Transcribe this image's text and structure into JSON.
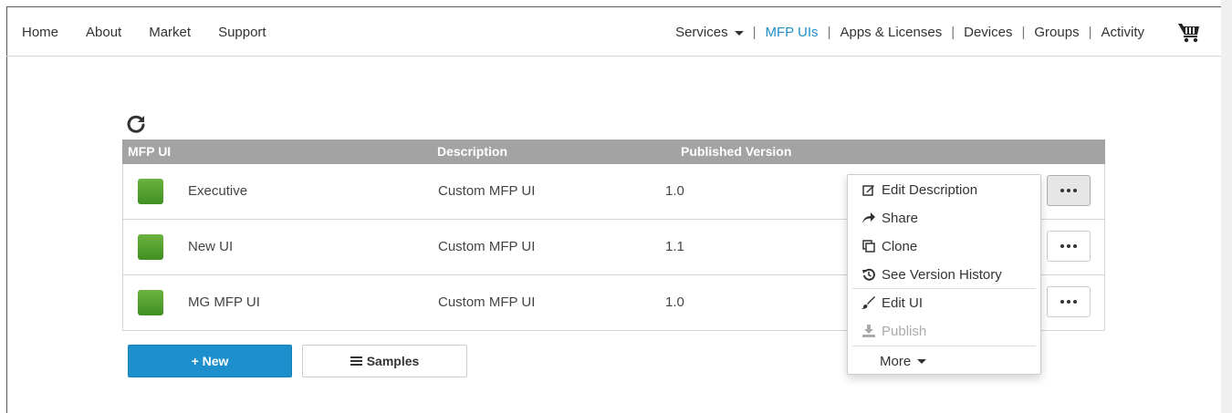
{
  "nav": {
    "left_items": [
      "Home",
      "About",
      "Market",
      "Support"
    ],
    "right_items": [
      {
        "label": "Services",
        "dropdown": true,
        "active": false
      },
      {
        "label": "MFP UIs",
        "dropdown": false,
        "active": true
      },
      {
        "label": "Apps & Licenses",
        "dropdown": false,
        "active": false
      },
      {
        "label": "Devices",
        "dropdown": false,
        "active": false
      },
      {
        "label": "Groups",
        "dropdown": false,
        "active": false
      },
      {
        "label": "Activity",
        "dropdown": false,
        "active": false
      }
    ],
    "separator": "|",
    "cart_icon": "cart-icon",
    "active_color": "#1f8fc7"
  },
  "table": {
    "headers": [
      "MFP UI",
      "Description",
      "Published Version"
    ],
    "rows": [
      {
        "name": "Executive",
        "description": "Custom MFP UI",
        "version": "1.0"
      },
      {
        "name": "New UI",
        "description": "Custom MFP UI",
        "version": "1.1"
      },
      {
        "name": "MG MFP UI",
        "description": "Custom MFP UI",
        "version": "1.0"
      }
    ],
    "header_color": "#a3a3a3"
  },
  "menu": {
    "items": [
      {
        "label": "Edit Description",
        "icon": "edit-icon",
        "disabled": false
      },
      {
        "label": "Share",
        "icon": "share-icon",
        "disabled": false
      },
      {
        "label": "Clone",
        "icon": "clone-icon",
        "disabled": false
      },
      {
        "label": "See Version History",
        "icon": "history-icon",
        "disabled": false
      },
      {
        "label": "Edit UI",
        "icon": "brush-icon",
        "disabled": false
      },
      {
        "label": "Publish",
        "icon": "publish-icon",
        "disabled": true
      },
      {
        "label": "More",
        "icon": "caret-down-icon",
        "disabled": false
      }
    ]
  },
  "buttons": {
    "new_label": "+ New",
    "samples_label": "Samples",
    "primary_color": "#1c8fcc"
  }
}
